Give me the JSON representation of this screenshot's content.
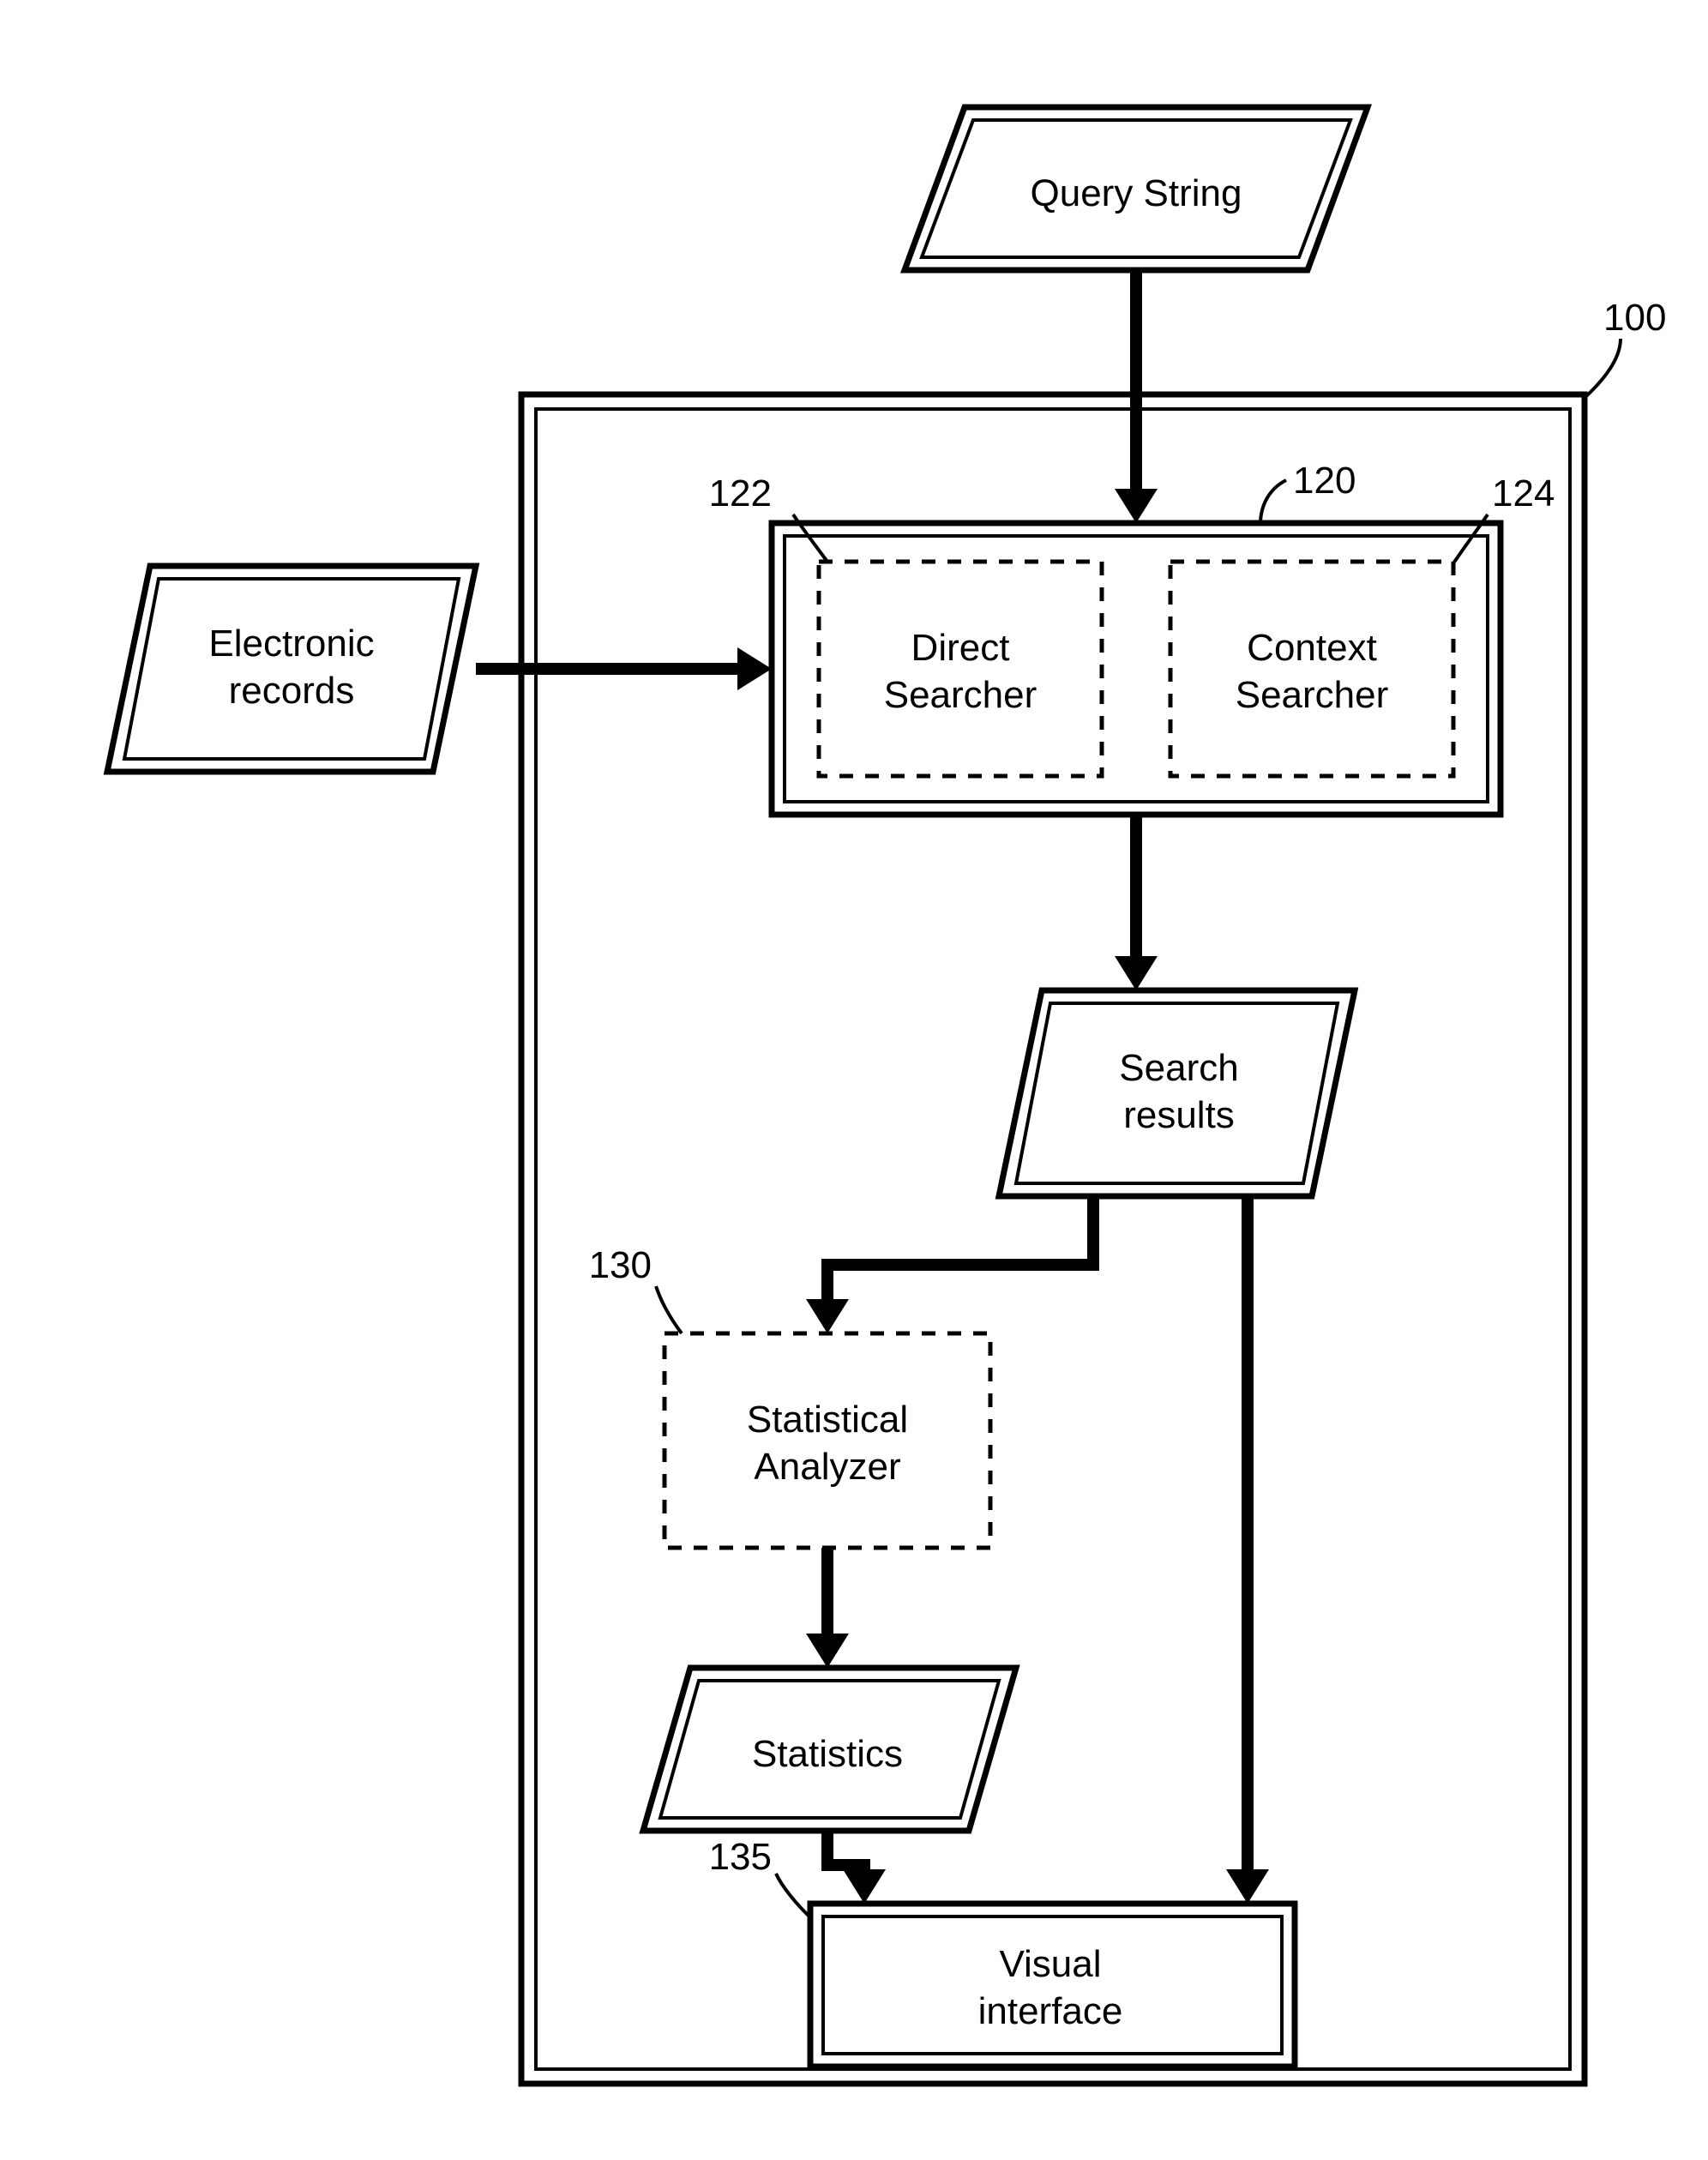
{
  "nodes": {
    "query_string": {
      "label": "Query String"
    },
    "electronic_records": {
      "label_line1": "Electronic",
      "label_line2": "records"
    },
    "direct_searcher": {
      "label_line1": "Direct",
      "label_line2": "Searcher"
    },
    "context_searcher": {
      "label_line1": "Context",
      "label_line2": "Searcher"
    },
    "search_results": {
      "label_line1": "Search",
      "label_line2": "results"
    },
    "statistical_analyzer": {
      "label_line1": "Statistical",
      "label_line2": "Analyzer"
    },
    "statistics": {
      "label": "Statistics"
    },
    "visual_interface": {
      "label_line1": "Visual",
      "label_line2": "interface"
    }
  },
  "refs": {
    "system": "100",
    "searcher_group": "120",
    "direct_searcher": "122",
    "context_searcher": "124",
    "statistical_analyzer": "130",
    "visual_interface": "135"
  }
}
